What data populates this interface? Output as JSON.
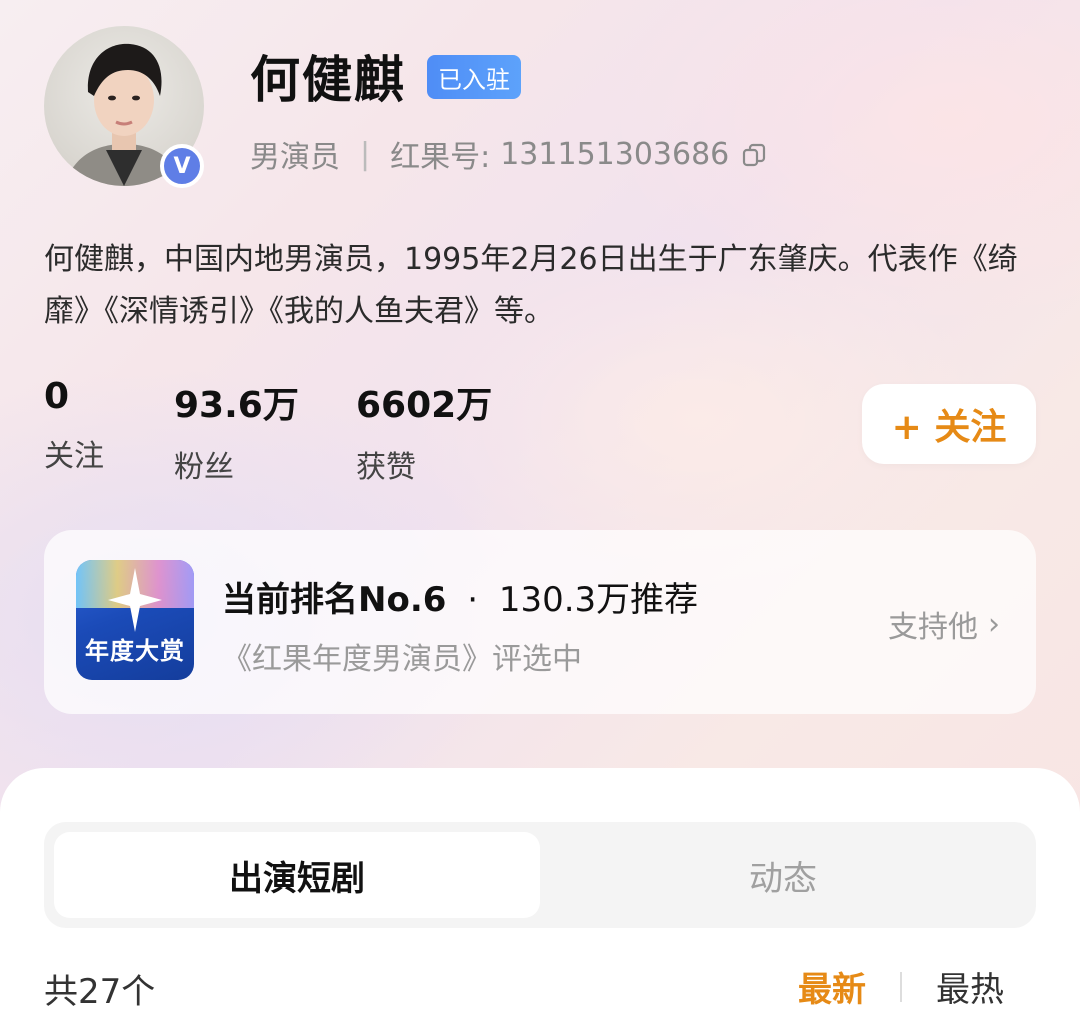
{
  "profile": {
    "name": "何健麒",
    "badge": "已入驻",
    "role": "男演员",
    "separator": "|",
    "id_label": "红果号:",
    "id_value": "131151303686",
    "verified_mark": "V",
    "bio": "何健麒，中国内地男演员，1995年2月26日出生于广东肇庆。代表作《绮靡》《深情诱引》《我的人鱼夫君》等。"
  },
  "stats": [
    {
      "value": "0",
      "label": "关注"
    },
    {
      "value": "93.6万",
      "label": "粉丝"
    },
    {
      "value": "6602万",
      "label": "获赞"
    }
  ],
  "follow_button": "+ 关注",
  "ranking": {
    "icon_text": "年度大赏",
    "rank": "当前排名No.6",
    "dot": "·",
    "recommend": "130.3万推荐",
    "subtitle": "《红果年度男演员》评选中",
    "support": "支持他",
    "support_chevron": "›"
  },
  "tabs": [
    {
      "label": "出演短剧",
      "active": true
    },
    {
      "label": "动态",
      "active": false
    }
  ],
  "list": {
    "count": "共27个",
    "sort_newest": "最新",
    "sort_hottest": "最热"
  },
  "colors": {
    "accent": "#e68a16",
    "badge_blue": "#4f8df6",
    "verified_blue": "#5f7ee6"
  }
}
